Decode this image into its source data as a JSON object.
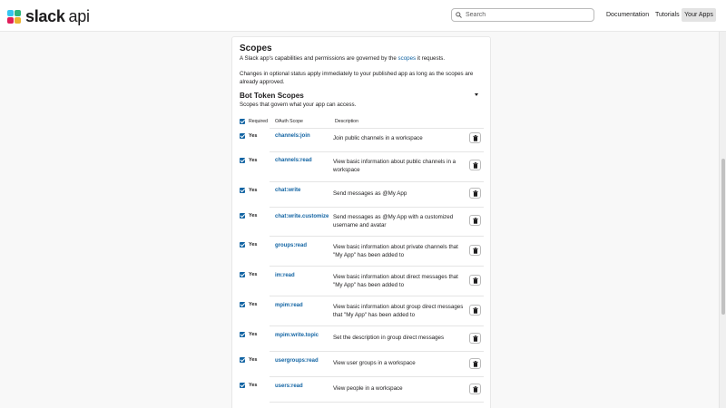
{
  "header": {
    "logo_text": "slack",
    "logo_sub": "api",
    "search_placeholder": "Search",
    "nav": [
      "Documentation",
      "Tutorials",
      "Your Apps"
    ]
  },
  "section": {
    "title": "Scopes",
    "intro_before": "A Slack app's capabilities and permissions are governed by the ",
    "intro_link": "scopes",
    "intro_after": " it requests.",
    "changes_text": "Changes in optional status apply immediately to your published app as long as the scopes are already approved."
  },
  "bot_scopes": {
    "title": "Bot Token Scopes",
    "subtitle": "Scopes that govern what your app can access.",
    "headers": {
      "required": "Required",
      "scope": "OAuth Scope",
      "description": "Description"
    },
    "rows": [
      {
        "required": "Yes",
        "scope": "channels:join",
        "description": "Join public channels in a workspace"
      },
      {
        "required": "Yes",
        "scope": "channels:read",
        "description": "View basic information about public channels in a workspace"
      },
      {
        "required": "Yes",
        "scope": "chat:write",
        "description": "Send messages as @My App"
      },
      {
        "required": "Yes",
        "scope": "chat:write.customize",
        "description": "Send messages as @My App with a customized username and avatar"
      },
      {
        "required": "Yes",
        "scope": "groups:read",
        "description": "View basic information about private channels that \"My App\" has been added to"
      },
      {
        "required": "Yes",
        "scope": "im:read",
        "description": "View basic information about direct messages that \"My App\" has been added to"
      },
      {
        "required": "Yes",
        "scope": "mpim:read",
        "description": "View basic information about group direct messages that \"My App\" has been added to"
      },
      {
        "required": "Yes",
        "scope": "mpim:write.topic",
        "description": "Set the description in group direct messages"
      },
      {
        "required": "Yes",
        "scope": "usergroups:read",
        "description": "View user groups in a workspace"
      },
      {
        "required": "Yes",
        "scope": "users:read",
        "description": "View people in a workspace"
      }
    ]
  },
  "colors": {
    "link": "#1264a3",
    "checkbox": "#1264a3"
  },
  "icons": {
    "search": "search-icon",
    "delete": "trash-icon",
    "collapse": "caret-down-icon"
  }
}
